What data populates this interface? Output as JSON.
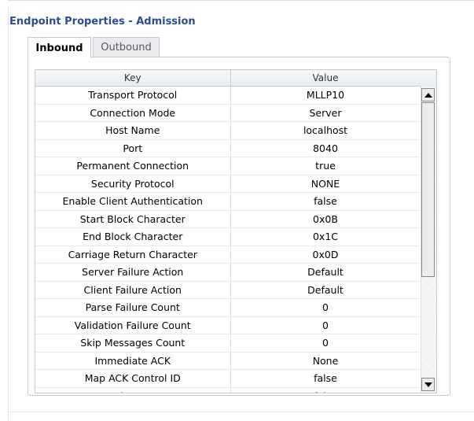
{
  "panel": {
    "title": "Endpoint Properties - Admission"
  },
  "tabs": [
    {
      "label": "Inbound",
      "active": true
    },
    {
      "label": "Outbound",
      "active": false
    }
  ],
  "table": {
    "columns": [
      "Key",
      "Value"
    ],
    "rows": [
      [
        "Transport Protocol",
        "MLLP10"
      ],
      [
        "Connection Mode",
        "Server"
      ],
      [
        "Host Name",
        "localhost"
      ],
      [
        "Port",
        "8040"
      ],
      [
        "Permanent Connection",
        "true"
      ],
      [
        "Security Protocol",
        "NONE"
      ],
      [
        "Enable Client Authentication",
        "false"
      ],
      [
        "Start Block Character",
        "0x0B"
      ],
      [
        "End Block Character",
        "0x1C"
      ],
      [
        "Carriage Return Character",
        "0x0D"
      ],
      [
        "Server Failure Action",
        "Default"
      ],
      [
        "Client Failure Action",
        "Default"
      ],
      [
        "Parse Failure Count",
        "0"
      ],
      [
        "Validation Failure Count",
        "0"
      ],
      [
        "Skip Messages Count",
        "0"
      ],
      [
        "Immediate ACK",
        "None"
      ],
      [
        "Map ACK Control ID",
        "false"
      ],
      [
        "Map Trigger Event",
        "false"
      ]
    ]
  },
  "scrollbar": {
    "up_icon": "triangle-up",
    "down_icon": "triangle-down"
  },
  "colors": {
    "title": "#2a4e8a",
    "border": "#c6c9cd",
    "header_bg": "#e8edf2"
  }
}
